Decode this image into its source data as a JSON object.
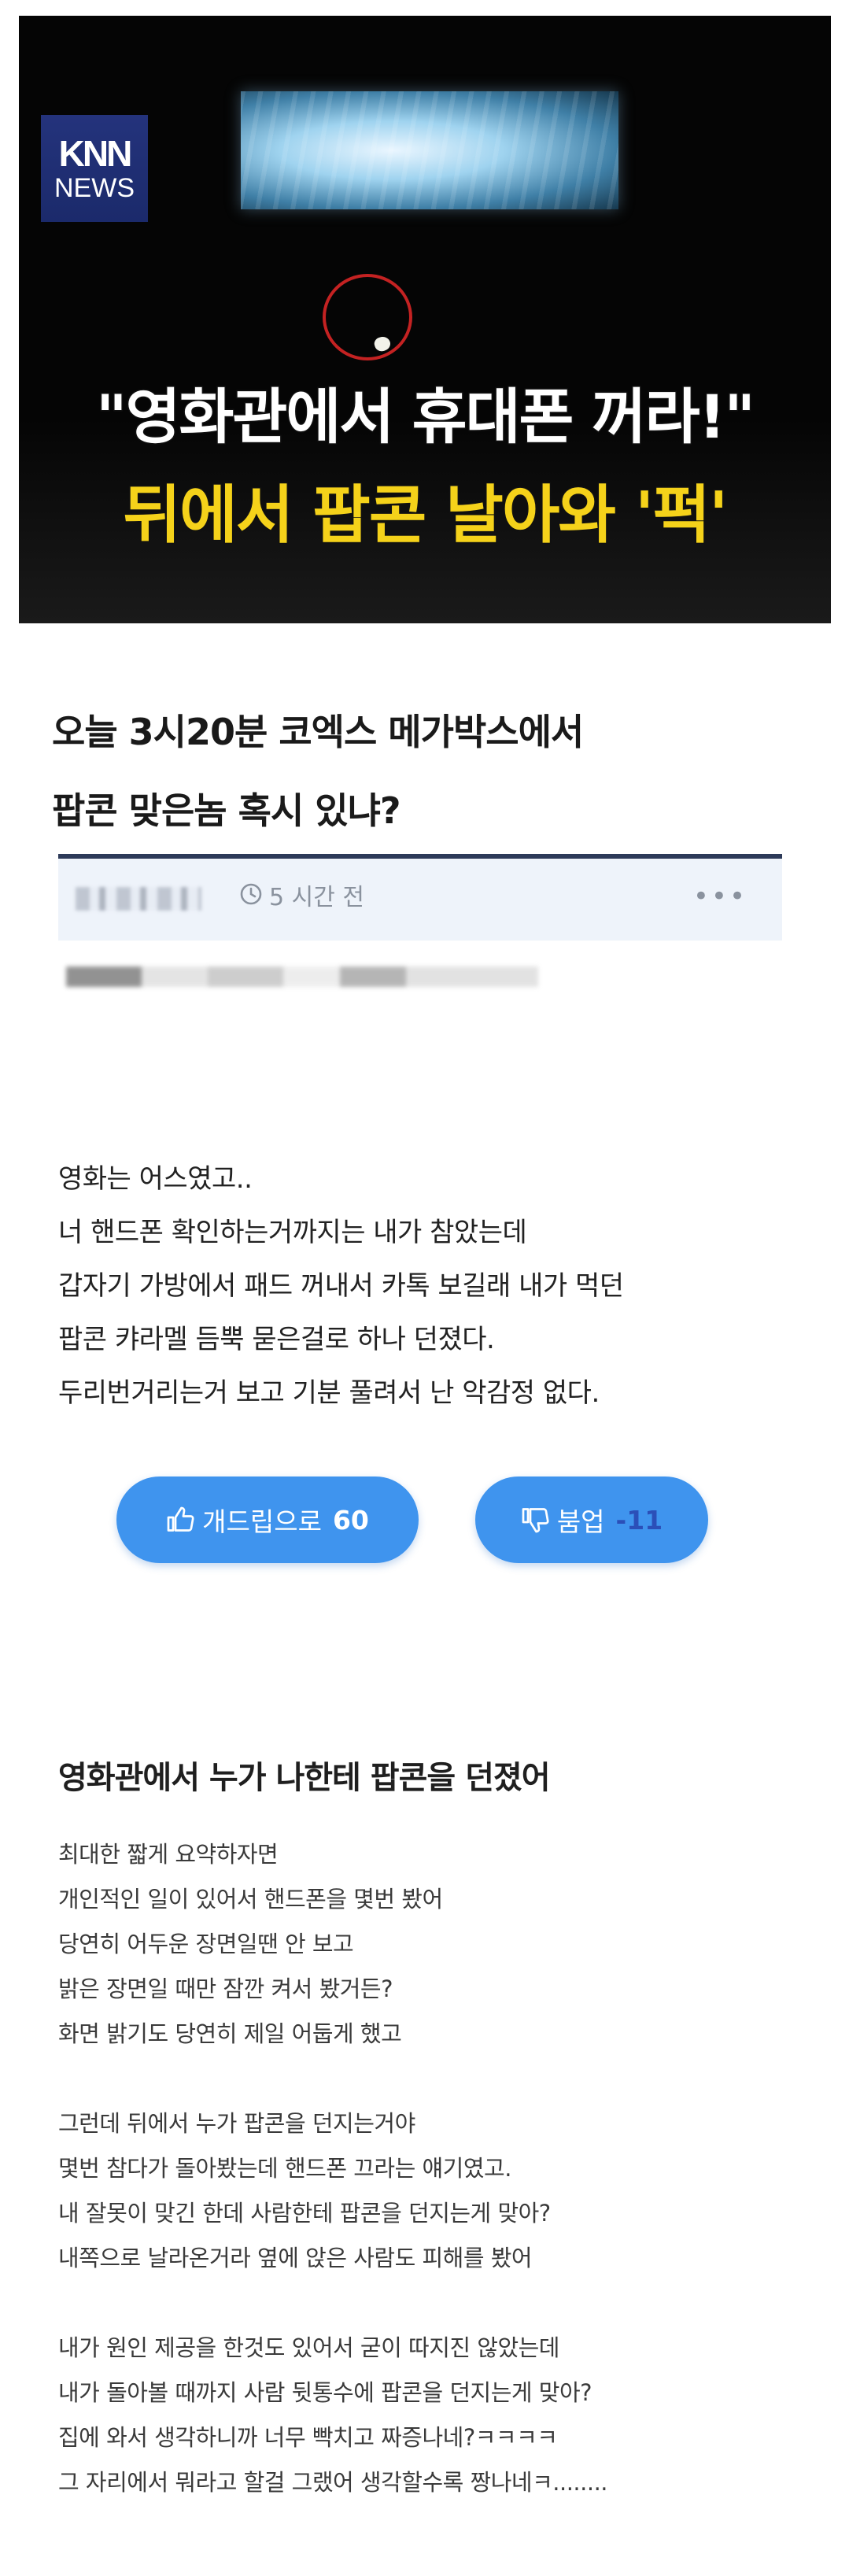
{
  "news": {
    "logo_top": "KNN",
    "logo_bottom": "NEWS",
    "headline_1": "\"영화관에서 휴대폰 꺼라!\"",
    "headline_2": "뒤에서 팝콘 날아와 '퍽'"
  },
  "post": {
    "title_line1": "오늘 3시20분 코엑스 메가박스에서",
    "title_line2": "팝콘 맞은놈 혹시 있냐?",
    "time": "5 시간 전",
    "body": [
      "영화는 어스였고..",
      "너 핸드폰 확인하는거까지는 내가 참았는데",
      "갑자기 가방에서 패드 꺼내서 카톡 보길래 내가 먹던",
      "팝콘 캬라멜 듬뿍 묻은걸로 하나 던졌다.",
      "두리번거리는거 보고 기분 풀려서 난 악감정 없다."
    ],
    "upvote": {
      "label": "개드립으로",
      "count": "60"
    },
    "downvote": {
      "label": "붐업",
      "count": "-11"
    }
  },
  "reply_post": {
    "title": "영화관에서 누가 나한테 팝콘을 던졌어",
    "paragraphs": [
      [
        "최대한 짧게 요약하자면",
        "개인적인 일이 있어서 핸드폰을 몇번 봤어",
        "당연히 어두운 장면일땐 안 보고",
        "밝은 장면일 때만 잠깐 켜서 봤거든?",
        "화면 밝기도 당연히 제일 어둡게 했고"
      ],
      [
        "그런데 뒤에서 누가 팝콘을 던지는거야",
        "몇번 참다가 돌아봤는데 핸드폰 끄라는 얘기였고.",
        "내 잘못이 맞긴 한데 사람한테 팝콘을 던지는게 맞아?",
        "내쪽으로 날라온거라 옆에 앉은 사람도 피해를 봤어"
      ],
      [
        "내가 원인 제공을 한것도 있어서 굳이 따지진 않았는데",
        "내가 돌아볼 때까지 사람 뒷통수에 팝콘을 던지는게 맞아?",
        "집에 와서 생각하니까 너무 빡치고 짜증나네?ㅋㅋㅋㅋ",
        "그 자리에서 뭐라고 할걸 그랬어 생각할수록 짱나네ㅋ........"
      ]
    ]
  },
  "colors": {
    "button_blue": "#3f94ee",
    "downvote_count": "#2b4fb8",
    "meta_bar": "#eef3fa",
    "meta_border": "#2d3a59",
    "headline_yellow": "#f5d21a",
    "circle_red": "#c42222",
    "logo_blue": "#1b2a6b"
  },
  "icons": {
    "time": "clock-icon",
    "more": "more-dots-icon",
    "upvote": "thumbs-up-icon",
    "downvote": "thumbs-down-icon"
  }
}
